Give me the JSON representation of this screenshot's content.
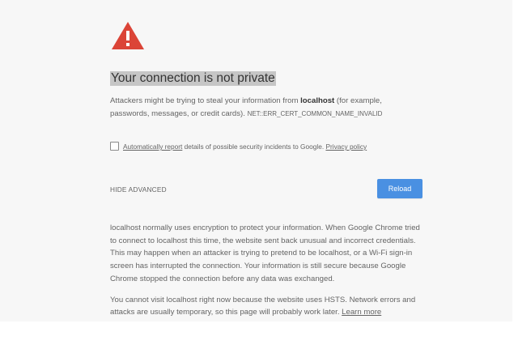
{
  "heading": "Your connection is not private",
  "message": {
    "before_host": "Attackers might be trying to steal your information from ",
    "host": "localhost",
    "after_host": " (for example, passwords, messages, or credit cards). ",
    "error_code": "NET::ERR_CERT_COMMON_NAME_INVALID"
  },
  "reporting": {
    "link_label": "Automatically report",
    "text": " details of possible security incidents to Google. ",
    "privacy_link": "Privacy policy",
    "checked": false
  },
  "actions": {
    "hide_advanced": "HIDE ADVANCED",
    "reload": "Reload"
  },
  "details": {
    "paragraph_1": "localhost normally uses encryption to protect your information. When Google Chrome tried to connect to localhost this time, the website sent back unusual and incorrect credentials. This may happen when an attacker is trying to pretend to be localhost, or a Wi-Fi sign-in screen has interrupted the connection. Your information is still secure because Google Chrome stopped the connection before any data was exchanged.",
    "paragraph_2_text": "You cannot visit localhost right now because the website uses HSTS. Network errors and attacks are usually temporary, so this page will probably work later. ",
    "learn_more": "Learn more"
  },
  "colors": {
    "warning_red": "#db4437",
    "reload_blue": "#4a90e2",
    "heading_highlight": "#c6c6c6"
  },
  "icons": {
    "warning": "warning-triangle-icon"
  }
}
